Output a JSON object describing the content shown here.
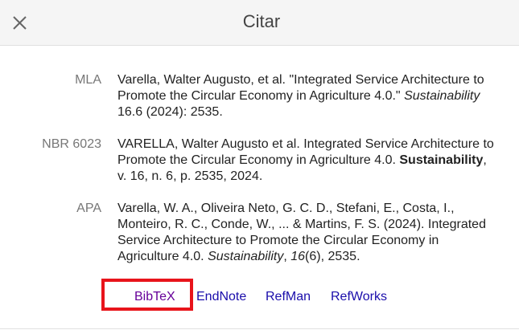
{
  "header": {
    "title": "Citar",
    "close_icon": "close-icon"
  },
  "citations": [
    {
      "label": "MLA",
      "parts": [
        {
          "t": "Varella, Walter Augusto, et al. \"Integrated Service Architecture to Promote the Circular Economy in Agriculture 4.0.\" ",
          "s": "normal"
        },
        {
          "t": "Sustainability",
          "s": "italic"
        },
        {
          "t": " 16.6 (2024): 2535.",
          "s": "normal"
        }
      ]
    },
    {
      "label": "NBR 6023",
      "parts": [
        {
          "t": "VARELLA, Walter Augusto et al. Integrated Service Architecture to Promote the Circular Economy in Agriculture 4.0. ",
          "s": "normal"
        },
        {
          "t": "Sustainability",
          "s": "bold"
        },
        {
          "t": ", v. 16, n. 6, p. 2535, 2024.",
          "s": "normal"
        }
      ]
    },
    {
      "label": "APA",
      "parts": [
        {
          "t": "Varella, W. A., Oliveira Neto, G. C. D., Stefani, E., Costa, I., Monteiro, R. C., Conde, W., ... & Martins, F. S. (2024). Integrated Service Architecture to Promote the Circular Economy in Agriculture 4.0. ",
          "s": "normal"
        },
        {
          "t": "Sustainability",
          "s": "italic"
        },
        {
          "t": ", ",
          "s": "normal"
        },
        {
          "t": "16",
          "s": "italic"
        },
        {
          "t": "(6), 2535.",
          "s": "normal"
        }
      ]
    }
  ],
  "links": {
    "bibtex": "BibTeX",
    "endnote": "EndNote",
    "refman": "RefMan",
    "refworks": "RefWorks"
  },
  "colors": {
    "link": "#1a0dab",
    "visited_link": "#660099",
    "highlight": "#e8141b"
  }
}
